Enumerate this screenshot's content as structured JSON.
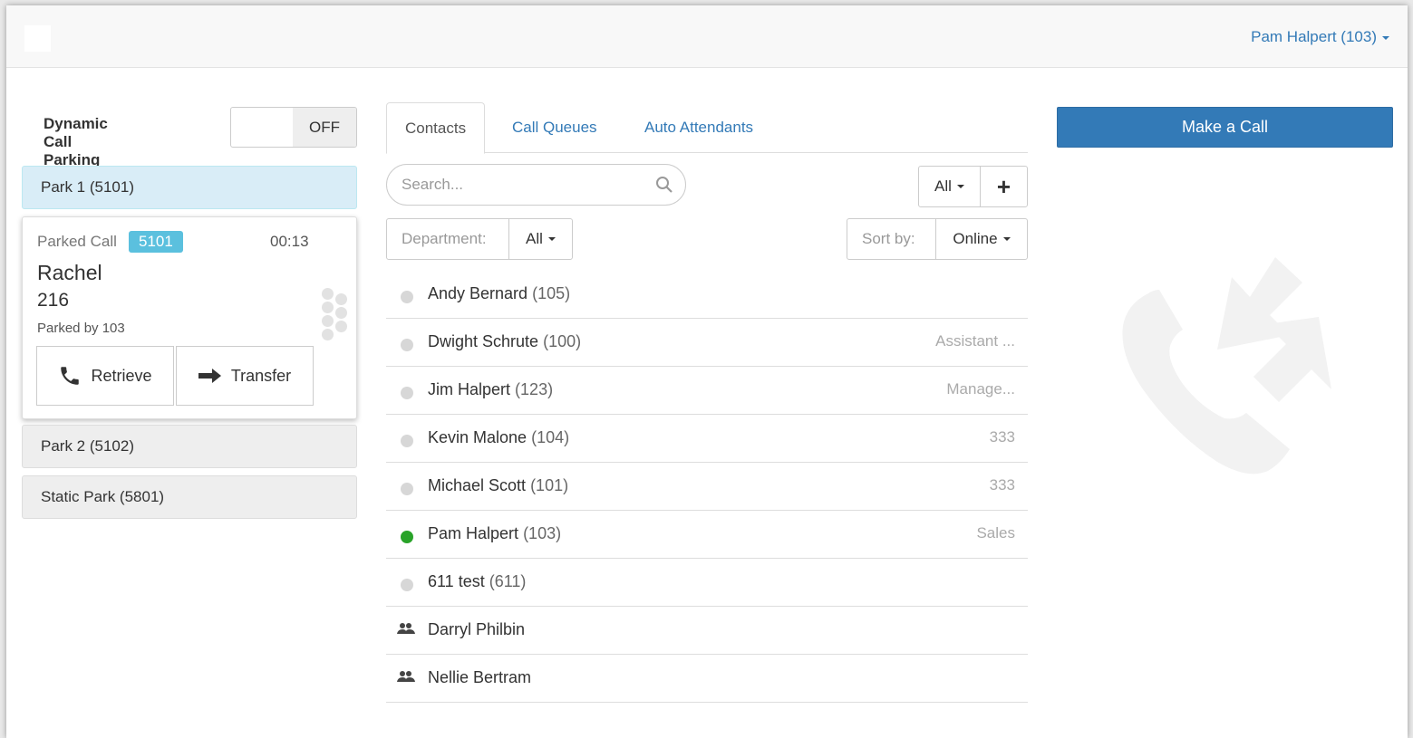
{
  "header": {
    "user_label": "Pam Halpert (103)"
  },
  "parking": {
    "dynamic_label": "Dynamic Call Parking",
    "toggle_state": "OFF",
    "parks": [
      {
        "label": "Park 1 (5101)"
      },
      {
        "label": "Park 2 (5102)"
      },
      {
        "label": "Static Park (5801)"
      }
    ],
    "parked_call": {
      "label": "Parked Call",
      "badge": "5101",
      "timer": "00:13",
      "caller_name": "Rachel",
      "caller_number": "216",
      "parked_by": "Parked by 103",
      "retrieve_label": "Retrieve",
      "transfer_label": "Transfer"
    }
  },
  "tabs": [
    {
      "label": "Contacts",
      "active": true
    },
    {
      "label": "Call Queues",
      "active": false
    },
    {
      "label": "Auto Attendants",
      "active": false
    }
  ],
  "search": {
    "placeholder": "Search..."
  },
  "filter": {
    "all_label": "All",
    "add_label": "+"
  },
  "department": {
    "label": "Department:",
    "value": "All"
  },
  "sort": {
    "label": "Sort by:",
    "value": "Online"
  },
  "contacts": [
    {
      "name": "Andy Bernard",
      "ext": "(105)",
      "dept": "",
      "status": "offline"
    },
    {
      "name": "Dwight Schrute",
      "ext": "(100)",
      "dept": "Assistant ...",
      "status": "offline"
    },
    {
      "name": "Jim Halpert",
      "ext": "(123)",
      "dept": "Manage...",
      "status": "offline"
    },
    {
      "name": "Kevin Malone",
      "ext": "(104)",
      "dept": "333",
      "status": "offline"
    },
    {
      "name": "Michael Scott",
      "ext": "(101)",
      "dept": "333",
      "status": "offline"
    },
    {
      "name": "Pam Halpert",
      "ext": "(103)",
      "dept": "Sales",
      "status": "online"
    },
    {
      "name": "611 test",
      "ext": "(611)",
      "dept": "",
      "status": "offline"
    },
    {
      "name": "Darryl Philbin",
      "ext": "",
      "dept": "",
      "status": "group"
    },
    {
      "name": "Nellie Bertram",
      "ext": "",
      "dept": "",
      "status": "group"
    }
  ],
  "actions": {
    "make_call_label": "Make a Call"
  },
  "colors": {
    "primary": "#337ab7",
    "online": "#29a329",
    "info_badge": "#5bc0de",
    "active_park": "#d9edf7"
  },
  "icons": [
    "caret-down-icon",
    "phone-icon",
    "arrow-right-icon",
    "search-icon",
    "group-icon",
    "plus-icon",
    "drag-handle-icon",
    "phone-transfer-icon"
  ]
}
